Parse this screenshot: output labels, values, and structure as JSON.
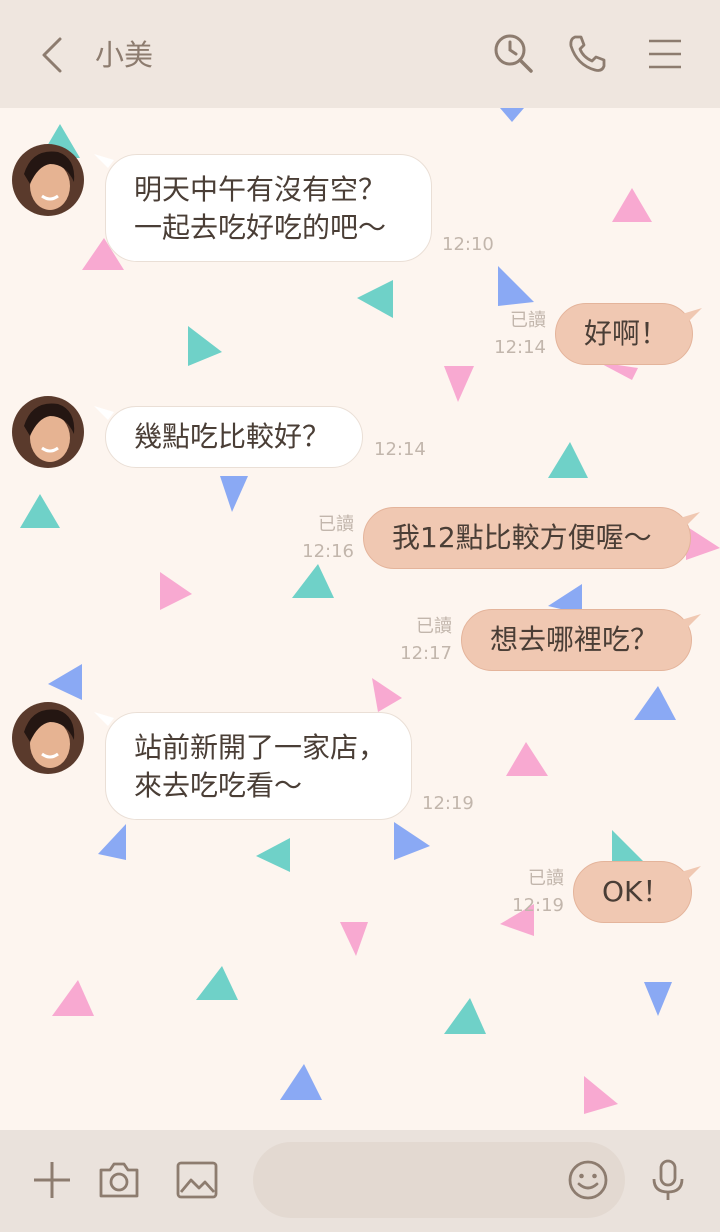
{
  "header": {
    "contact_name": "小美"
  },
  "messages": [
    {
      "dir": "in",
      "lines": [
        "明天中午有沒有空？",
        "一起去吃好吃的吧～"
      ],
      "time": "12:10"
    },
    {
      "dir": "out",
      "lines": [
        "好啊！"
      ],
      "read": "已讀",
      "time": "12:14"
    },
    {
      "dir": "in",
      "lines": [
        "幾點吃比較好？"
      ],
      "time": "12:14"
    },
    {
      "dir": "out",
      "lines": [
        "我12點比較方便喔～"
      ],
      "read": "已讀",
      "time": "12:16"
    },
    {
      "dir": "out",
      "lines": [
        "想去哪裡吃？"
      ],
      "read": "已讀",
      "time": "12:17"
    },
    {
      "dir": "in",
      "lines": [
        "站前新開了一家店，",
        "來去吃吃看～"
      ],
      "time": "12:19"
    },
    {
      "dir": "out",
      "lines": [
        "OK！"
      ],
      "read": "已讀",
      "time": "12:19"
    }
  ],
  "colors": {
    "teal": "#6fd1c8",
    "pink": "#f8a9d1",
    "blue": "#8aa9f4",
    "bubble_out": "#f0c8b2",
    "header_bg": "#efe6df"
  },
  "icons": {
    "back": "chevron-left-icon",
    "search": "search-clock-icon",
    "call": "phone-icon",
    "menu": "hamburger-menu-icon",
    "plus": "plus-icon",
    "camera": "camera-icon",
    "image": "image-icon",
    "emoji": "smiley-icon",
    "mic": "microphone-icon"
  }
}
